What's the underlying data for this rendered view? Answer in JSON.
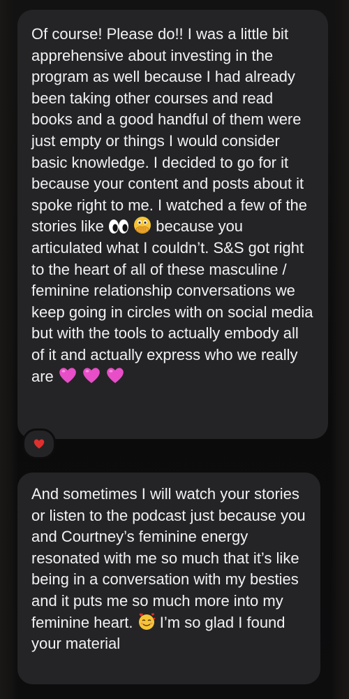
{
  "messages": [
    {
      "segments": {
        "a": "Of course! Please do!! I was a little bit apprehensive about investing in the program as well because I had already been taking other courses and read books and a good handful of them were just empty or things I would consider basic knowledge. I decided to go for it because your content and posts about it spoke right to me. I watched a few of the stories like ",
        "b": " because you articulated what I couldn’t. S&S got right to the heart of all of these masculine / feminine relationship conversations we keep going in circles with on social media but with the tools to actually embody all of it and actually express who we really are "
      },
      "emojis": [
        "eyes",
        "face-with-open-eyes-and-hand-over-mouth",
        "pink-heart",
        "pink-heart",
        "pink-heart"
      ],
      "reaction": "red-heart"
    },
    {
      "segments": {
        "a": "And sometimes I will watch your stories or listen to the podcast just because you and Courtney’s feminine energy resonated with me so much that it’s like being in a conversation with my besties and it puts me so much more into my feminine heart. ",
        "b": " I’m so glad I found your material"
      },
      "emojis": [
        "smiling-face-with-hearts"
      ]
    }
  ],
  "colors": {
    "bubble": "#242426",
    "text": "#f2f2f4",
    "background": "#0b0b0c",
    "pink_heart": "#e84ec7",
    "red_heart": "#e0302d"
  }
}
